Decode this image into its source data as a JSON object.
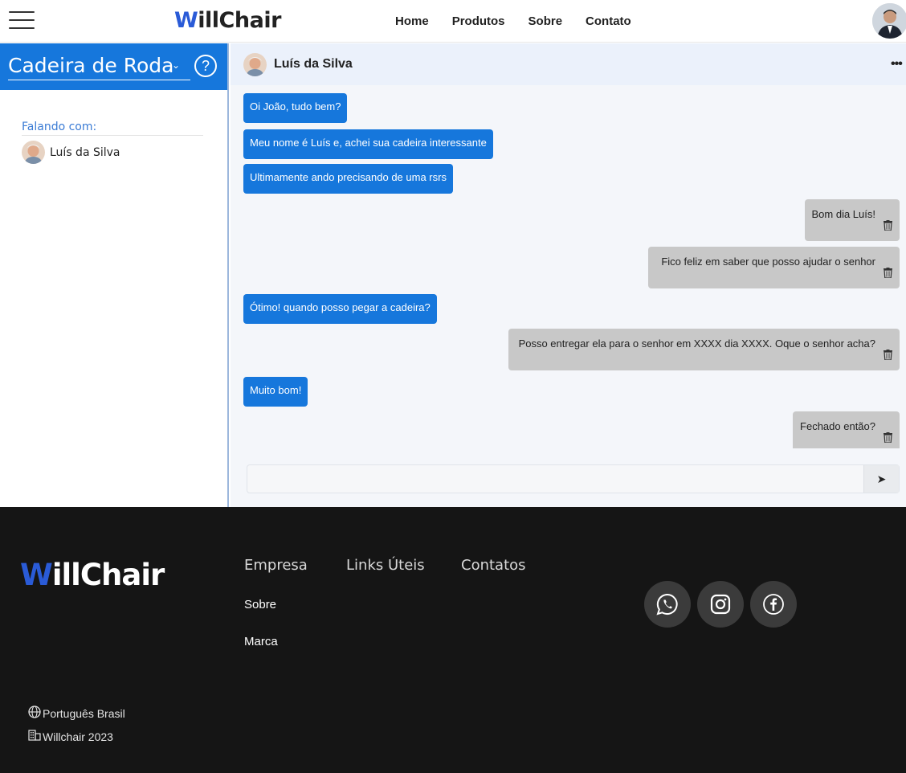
{
  "navbar": {
    "logo_w": "W",
    "logo_rest": "illChair",
    "links": [
      "Home",
      "Produtos",
      "Sobre",
      "Contato"
    ]
  },
  "sidebar": {
    "category": "Cadeira de Roda",
    "help": "?",
    "talking_label": "Falando com:",
    "contact_name": "Luís da Silva"
  },
  "chat": {
    "contact_name": "Luís da Silva",
    "messages": [
      {
        "from": "in",
        "text": "Oi João, tudo bem?"
      },
      {
        "from": "in",
        "text": "Meu nome é Luís e, achei sua cadeira interessante"
      },
      {
        "from": "in",
        "text": "Ultimamente ando precisando de uma rsrs"
      },
      {
        "from": "out",
        "text": "Bom dia Luís!"
      },
      {
        "from": "out",
        "text": "Fico feliz em saber que posso ajudar o senhor"
      },
      {
        "from": "in",
        "text": "Ótimo! quando posso pegar a cadeira?"
      },
      {
        "from": "out",
        "text": "Posso entregar ela para o senhor em XXXX dia XXXX. Oque o senhor acha?"
      },
      {
        "from": "in",
        "text": "Muito bom!"
      },
      {
        "from": "out",
        "text": "Fechado então?"
      }
    ],
    "input_value": "",
    "send_icon": "➤"
  },
  "footer": {
    "logo_w": "W",
    "logo_rest": "illChair",
    "columns": [
      "Empresa",
      "Links Úteis",
      "Contatos"
    ],
    "company_links": [
      "Sobre",
      "Marca"
    ],
    "social_icons": [
      "whatsapp-icon",
      "instagram-icon",
      "facebook-icon"
    ],
    "language": "Português Brasil",
    "copyright": "Willchair 2023"
  },
  "colors": {
    "primary": "#1677dc",
    "footer_bg": "#151515",
    "outgoing_bubble": "#c8c8c8",
    "logo_accent": "#2a5bd7"
  }
}
